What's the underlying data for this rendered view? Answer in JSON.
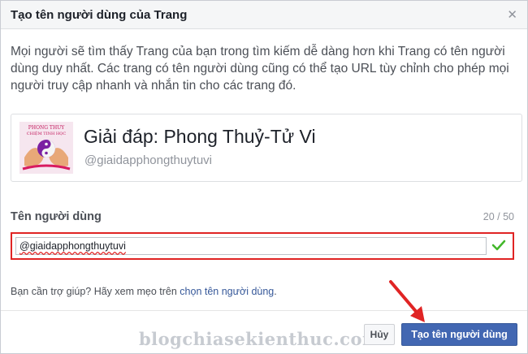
{
  "dialog": {
    "title": "Tạo tên người dùng của Trang",
    "close_icon": "close-icon",
    "description": "Mọi người sẽ tìm thấy Trang của bạn trong tìm kiếm dễ dàng hơn khi Trang có tên người dùng duy nhất. Các trang có tên người dùng cũng có thể tạo URL tùy chỉnh cho phép mọi người truy cập nhanh và nhắn tin cho các trang đó."
  },
  "preview": {
    "avatar_line1": "PHONG THUY",
    "avatar_line2": "CHIỆM TINH HỌC",
    "page_name": "Giải đáp: Phong Thuỷ-Tử Vi",
    "handle": "@giaidapphongthuytuvi"
  },
  "field": {
    "label": "Tên người dùng",
    "counter": "20 / 50",
    "value": "@giaidapphongthuytuvi",
    "valid_icon": "checkmark-icon",
    "highlight_color": "#e02424"
  },
  "help": {
    "text": "Bạn cần trợ giúp? Hãy xem mẹo trên ",
    "link": "chọn tên người dùng",
    "suffix": "."
  },
  "footer": {
    "cancel_label": "Hủy",
    "create_label": "Tạo tên người dùng",
    "watermark": "blogchiasekienthuc.com",
    "primary_color": "#4267b2",
    "arrow_icon": "red-arrow-icon"
  }
}
